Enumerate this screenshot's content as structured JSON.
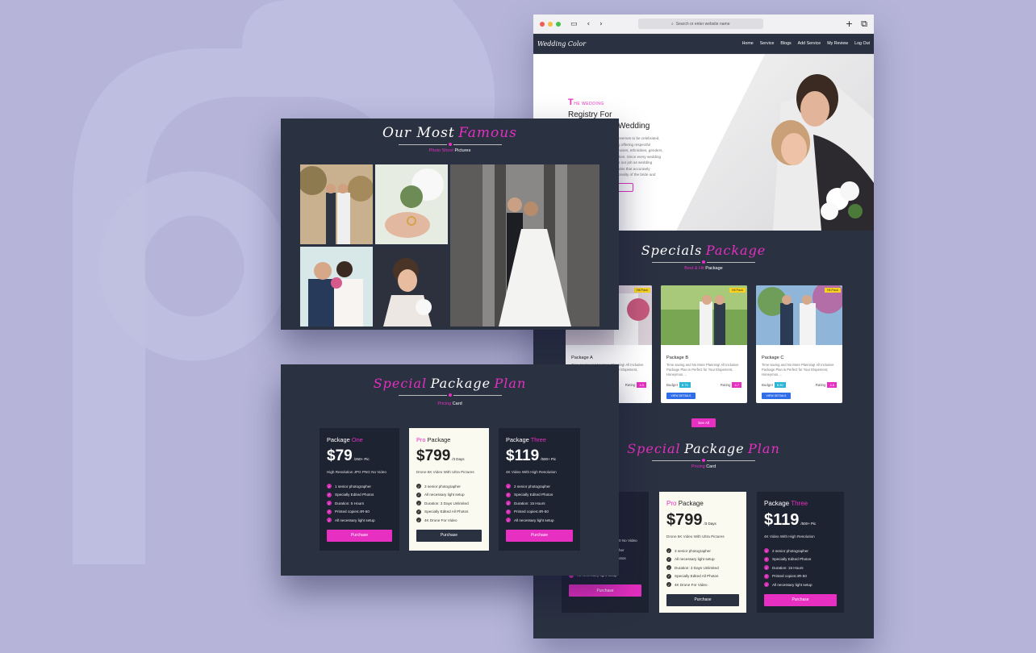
{
  "colors": {
    "accent": "#e72fc2",
    "panel": "#2a3140",
    "card_dark": "#1e2332",
    "card_light": "#fbfaf1",
    "button_blue": "#2f6ee8"
  },
  "browser": {
    "url_placeholder": "Search or enter website name",
    "logo": "Wedding Color",
    "nav": [
      "Home",
      "Service",
      "Blogs",
      "Add Service",
      "My Review",
      "Log Out"
    ],
    "hero": {
      "kicker_first": "T",
      "kicker_rest": "HE WEDDING",
      "line1": "Registry For",
      "line2": "Wedding",
      "paragraph_lines": [
        "eserves to be celebrated,",
        "g offering respectful",
        "noses, ethnicities, genders,",
        "ities. Since every wedding",
        "s our job as wedding",
        "ides that accurately",
        "onality of the bride and"
      ]
    },
    "specials": {
      "title_a": "Specials",
      "title_b": "Package",
      "sub_a": "Best & Hit",
      "sub_b": "Package",
      "cards": [
        {
          "badge": "Hit Pack",
          "title": "Package A",
          "desc": "Time saving and No More Planning! All Inclusive Package Plan is Perfect for Your Elopement, Honeymoo ...",
          "budget_label": "",
          "budget": "",
          "rating_label": "Rating",
          "rating": "4.5",
          "button": ""
        },
        {
          "badge": "Hit Pack",
          "title": "Package B",
          "desc": "Time saving and No More Planning! All Inclusive Package Plan is Perfect for Your Elopement, Honeymoo ...",
          "budget_label": "Budget",
          "budget": "$ 75",
          "rating_label": "Rating",
          "rating": "4.7",
          "button": "VIEW DETAILS"
        },
        {
          "badge": "Hit Pack",
          "title": "Package C",
          "desc": "Time saving and No More Planning! All Inclusive Package Plan is Perfect for Your Elopement, Honeymoo ...",
          "budget_label": "Budget",
          "budget": "$ 80",
          "rating_label": "Rating",
          "rating": "4.8",
          "button": "VIEW DETAILS"
        }
      ],
      "see_all": "See All"
    },
    "plan": {
      "title_a": "Special",
      "title_b": "Package",
      "title_c": "Plan",
      "sub_a": "Pricing",
      "sub_b": "Card",
      "left_partial_desc": "0 No Video",
      "left_partial_items": [
        "her",
        "otos",
        "",
        "All necessary light setup"
      ],
      "pro": {
        "title_a": "Pro",
        "title_b": "Package",
        "price": "$799",
        "unit": "/3 Days",
        "desc": "Drone 5K Video With Ultra Pictures",
        "items": [
          "3 senior photographer",
          "All necessary light setup",
          "Duration: 3 Days Unlimited",
          "Specially Edited All Photos",
          "4K Drone For Video"
        ],
        "button": "Purchase"
      },
      "three": {
        "title_a": "Package",
        "title_b": "Three",
        "price": "$119",
        "unit": "/500+ Pic",
        "desc": "4K Video With High Resolution",
        "items": [
          "2 senior photographer",
          "Specially Edited Photos",
          "Duration: 15 Hours",
          "Printed copies:4R-50",
          "All necessary light setup"
        ],
        "button": "Purchase"
      },
      "left_button": "Purchase"
    }
  },
  "gallery": {
    "title_a": "Our Most",
    "title_b": "Famous",
    "sub_a": "Photo Shoot",
    "sub_b": "Pictures"
  },
  "pricing": {
    "title_a": "Special",
    "title_b": "Package",
    "title_c": "Plan",
    "sub_a": "Pricing",
    "sub_b": "Card",
    "cards": [
      {
        "title_a": "Package",
        "title_b": "One",
        "price": "$79",
        "unit": "/250+ Pic",
        "desc": "High Resolution JPG PNG No Video",
        "items": [
          "1 senior photographer",
          "Specially Edited Photos",
          "Duration: 5 Hours",
          "Printed copies:4R-50",
          "All necessary light setup"
        ],
        "button": "Purchase"
      },
      {
        "title_a": "Pro",
        "title_b": "Package",
        "price": "$799",
        "unit": "/3 Days",
        "desc": "Drone 5K Video With Ultra Pictures",
        "items": [
          "3 senior photographer",
          "All necessary light setup",
          "Duration: 3 Days Unlimited",
          "Specially Edited All Photos",
          "4K Drone For Video"
        ],
        "button": "Purchase"
      },
      {
        "title_a": "Package",
        "title_b": "Three",
        "price": "$119",
        "unit": "/500+ Pic",
        "desc": "4K Video With High Resolution",
        "items": [
          "2 senior photographer",
          "Specially Edited Photos",
          "Duration: 15 Hours",
          "Printed copies:4R-50",
          "All necessary light setup"
        ],
        "button": "Purchase"
      }
    ]
  }
}
